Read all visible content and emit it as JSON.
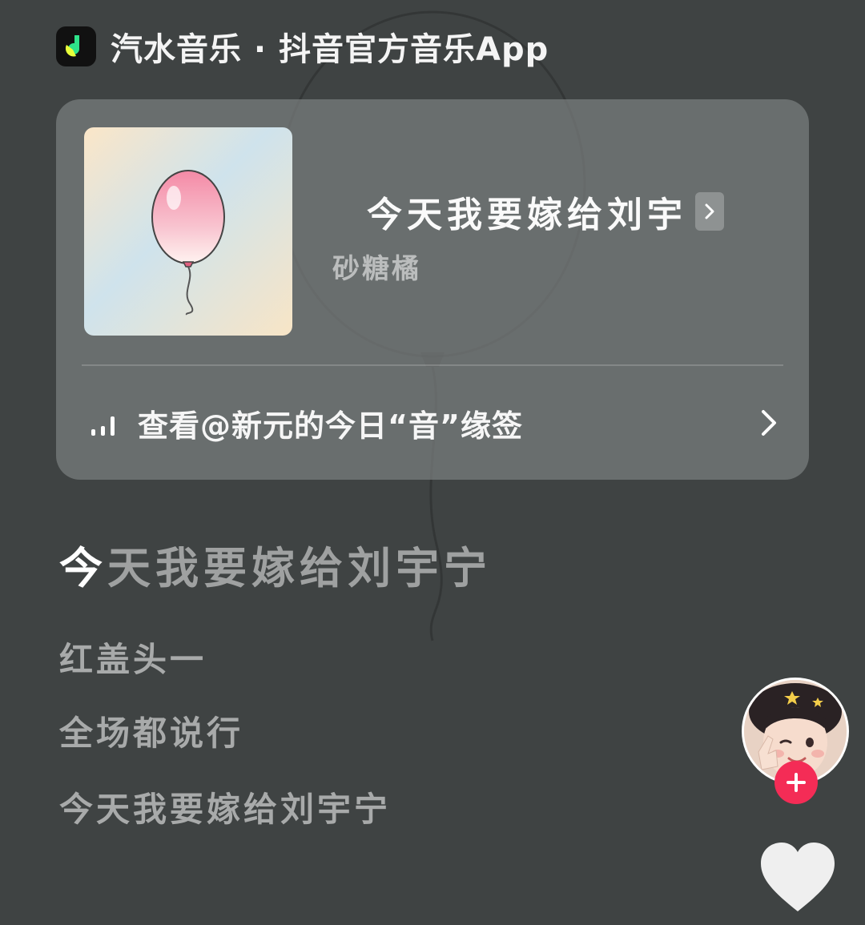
{
  "app": {
    "title": "汽水音乐 · 抖音官方音乐App",
    "logo_icon": "music-note-icon"
  },
  "song_card": {
    "title": "今天我要嫁给刘宇",
    "artist": "砂糖橘",
    "cover_icon": "balloon-icon",
    "mood_link": "查看@新元的今日“音”缘签"
  },
  "lyrics": {
    "current_highlight": "今",
    "current_rest": "天我要嫁给刘宇宁",
    "lines": [
      "红盖头一",
      "全场都说行",
      "今天我要嫁给刘宇宁"
    ]
  },
  "actions": {
    "follow_icon": "plus-icon",
    "like_icon": "heart-icon"
  },
  "colors": {
    "background": "#3f4343",
    "card": "#787c7c",
    "follow": "#f42c56",
    "logo_green": "#2fe38a",
    "logo_yellow": "#e8ff3a"
  }
}
